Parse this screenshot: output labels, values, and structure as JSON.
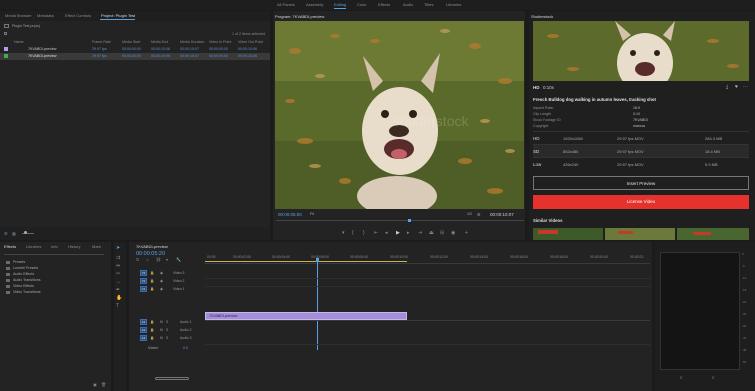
{
  "workspaces": [
    "All Panels",
    "Assembly",
    "Editing",
    "Color",
    "Effects",
    "Audio",
    "Titles",
    "Libraries"
  ],
  "workspace_active": "Editing",
  "project_panel": {
    "tabs": [
      "Media Browser",
      "Metadata",
      "Effect Controls",
      "Project: Plugin Test"
    ],
    "active_tab": "Project: Plugin Test",
    "file_name": "Plugin Test.prproj",
    "selection_status": "1 of 2 items selected",
    "columns": [
      "Name",
      "Frame Rate",
      "Media Start",
      "Media End",
      "Media Duration",
      "Video In Point",
      "Video Out Point"
    ],
    "rows": [
      {
        "name": "7KVABDI-preview",
        "frame_rate": "29.97 fps",
        "start": "00;00;00;00",
        "end": "00;00;10;06",
        "duration": "00;00;10;07",
        "in": "00;00;00;00",
        "out": "00;00;10;06",
        "color": "#b49af0"
      },
      {
        "name": "7KVABDI-preview",
        "frame_rate": "29.97 fps",
        "start": "00;00;00;00",
        "end": "00;00;10;06",
        "duration": "00;00;10;07",
        "in": "00;00;00;00",
        "out": "00;00;10;06",
        "color": "#3fae4f"
      }
    ]
  },
  "program": {
    "title": "Program: 7KVABDI-preview",
    "timecode": "00:00:05:00",
    "fit": "Fit",
    "resolution": "1/2",
    "duration": "00:00:10:07",
    "watermark": "shutterstock"
  },
  "shutterstock": {
    "tab": "Shutterstock",
    "hd_label": "HD",
    "length": "0:10s",
    "title": "French Bulldog dog walking in autumn leaves, tracking shot",
    "meta": [
      {
        "k": "Aspect Ratio",
        "v": "16:9"
      },
      {
        "k": "Clip Length",
        "v": "0:10"
      },
      {
        "k": "Stock Footage ID",
        "v": "7KVABDI"
      },
      {
        "k": "Copyright",
        "v": "marusa"
      }
    ],
    "formats": [
      {
        "name": "HD",
        "res": "1920x1080",
        "spec": "29.97 fps MOV",
        "size": "284.3 MB"
      },
      {
        "name": "SD",
        "res": "852x480",
        "spec": "29.97 fps MOV",
        "size": "18.4 MB"
      },
      {
        "name": "Low",
        "res": "426x240",
        "spec": "29.97 fps MOV",
        "size": "5.9 MB"
      }
    ],
    "insert_label": "Insert Preview",
    "license_label": "License Video",
    "similar_label": "Similar Videos",
    "accent": "#e5322d"
  },
  "effects": {
    "tabs": [
      "Effects",
      "Libraries",
      "Info",
      "History",
      "Mark"
    ],
    "active_tab": "Effects",
    "items": [
      "Presets",
      "Lumetri Presets",
      "Audio Effects",
      "Audio Transitions",
      "Video Effects",
      "Video Transitions"
    ]
  },
  "timeline": {
    "sequence": "7KVABDI-preview",
    "timecode": "00:00:05:20",
    "ruler": [
      "00:00",
      "00:00:02:00",
      "00:00:04:00",
      "00:00:06:00",
      "00:00:08:00",
      "00:00:10:00",
      "00:00:12:00",
      "00:00:14:00",
      "00:00:16:00",
      "00:00:18:00",
      "00:00:20:00",
      "00:00:22:"
    ],
    "video_tracks": [
      "Video 3",
      "Video 2",
      "Video 1"
    ],
    "audio_tracks": [
      "Audio 1",
      "Audio 2",
      "Audio 3"
    ],
    "master": "Master",
    "master_value": "0.0",
    "clip_label": "7KVABDI-preview",
    "v_ids": [
      "V3",
      "V2",
      "V1"
    ],
    "a_ids": [
      "A1",
      "A2",
      "A3"
    ]
  },
  "meters": {
    "scale": [
      "0",
      "-6",
      "-12",
      "-18",
      "-24",
      "-30",
      "-36",
      "-42",
      "-48",
      "-54"
    ],
    "bottom": [
      "S",
      "S"
    ]
  }
}
